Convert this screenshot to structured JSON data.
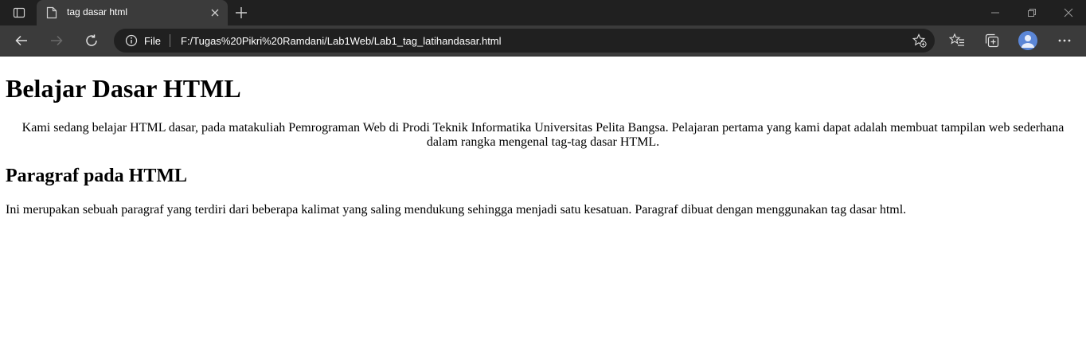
{
  "browser": {
    "tab": {
      "title": "tag dasar html"
    },
    "address": {
      "scheme_label": "File",
      "url": "F:/Tugas%20Pikri%20Ramdani/Lab1Web/Lab1_tag_latihandasar.html"
    },
    "colors": {
      "tab_strip": "#202020",
      "toolbar": "#3b3b3b",
      "omnibox": "#202020",
      "text": "#ffffff",
      "icon": "#cfcfcf",
      "disabled_icon": "#6b6b6b"
    }
  },
  "page": {
    "heading1": "Belajar Dasar HTML",
    "intro_paragraph": "Kami sedang belajar HTML dasar, pada matakuliah Pemrograman Web di Prodi Teknik Informatika Universitas Pelita Bangsa. Pelajaran pertama yang kami dapat adalah membuat tampilan web sederhana dalam rangka mengenal tag-tag dasar HTML.",
    "heading2": "Paragraf pada HTML",
    "body_paragraph": "Ini merupakan sebuah paragraf yang terdiri dari beberapa kalimat yang saling mendukung sehingga menjadi satu kesatuan. Paragraf dibuat dengan menggunakan tag dasar html."
  }
}
